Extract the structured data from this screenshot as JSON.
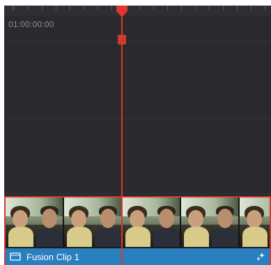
{
  "timeline": {
    "timecode": "01:00:00:00",
    "playhead_color": "#e0362c"
  },
  "clip": {
    "title": "Fusion Clip 1",
    "label_color": "#2a7fbf",
    "border_color": "#d33a2f",
    "type_icon": "clip-type-icon",
    "effect_icon": "sparkle-icon"
  }
}
